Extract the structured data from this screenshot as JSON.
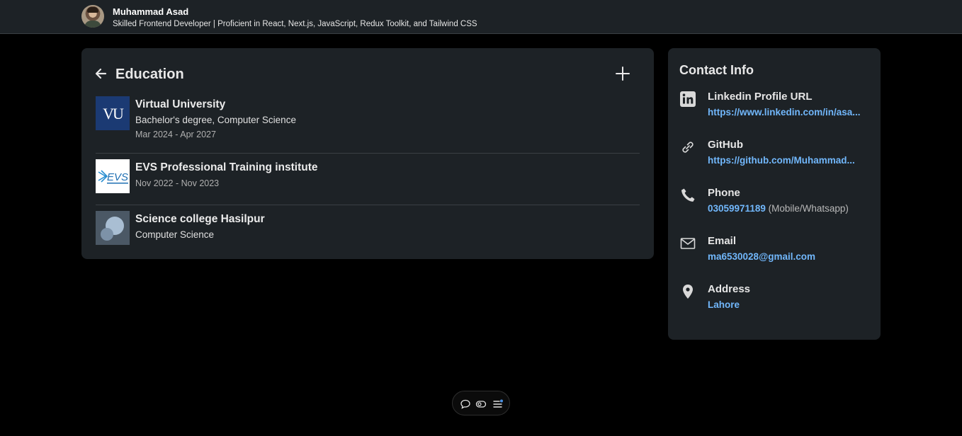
{
  "header": {
    "name": "Muhammad Asad",
    "headline": "Skilled Frontend Developer | Proficient in React, Next.js, JavaScript, Redux Toolkit, and Tailwind CSS"
  },
  "education": {
    "title": "Education",
    "items": [
      {
        "school": "Virtual University",
        "degree": "Bachelor's degree, Computer Science",
        "dates": "Mar 2024 - Apr 2027",
        "logo_text": "VU"
      },
      {
        "school": "EVS Professional Training institute",
        "dates": "Nov 2022 - Nov 2023",
        "logo_text": "EVS"
      },
      {
        "school": "Science college Hasilpur",
        "degree": "Computer Science"
      }
    ]
  },
  "contact": {
    "title": "Contact Info",
    "items": [
      {
        "label": "Linkedin Profile URL",
        "value": "https://www.linkedin.com/in/asa...",
        "icon": "linkedin-icon"
      },
      {
        "label": "GitHub",
        "value": "https://github.com/Muhammad...",
        "icon": "link-icon"
      },
      {
        "label": "Phone",
        "value": "03059971189",
        "extra": "(Mobile/Whatsapp)",
        "icon": "phone-icon"
      },
      {
        "label": "Email",
        "value": "ma6530028@gmail.com",
        "icon": "mail-icon"
      },
      {
        "label": "Address",
        "value": "Lahore",
        "icon": "location-pin-icon"
      }
    ]
  },
  "toolbar": {
    "icons": [
      "comment-icon",
      "toggle-icon",
      "notes-list-icon"
    ]
  },
  "colors": {
    "background": "#000000",
    "card": "#1d2226",
    "link": "#71b7fb",
    "divider": "#3a3f44"
  }
}
